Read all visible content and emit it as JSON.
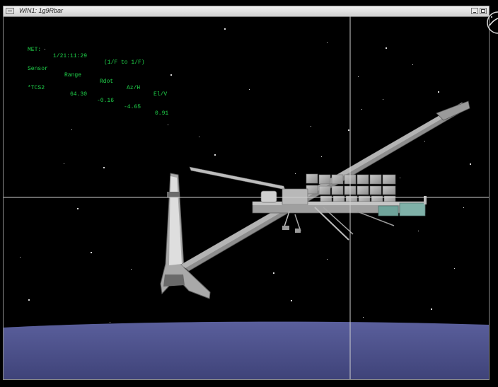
{
  "window": {
    "title": "WIN1: 1g9Rbar"
  },
  "telemetry": {
    "met_label": "MET:",
    "met_value": "1/21:11:29",
    "mode": "(1/F to 1/F)",
    "headers": [
      "Sensor",
      "Range",
      "Rdot",
      "Az/H",
      "El/V"
    ],
    "row": [
      "*TCS2",
      "64.30",
      "-0.16",
      "-4.65",
      "0.91"
    ]
  },
  "colors": {
    "telemetry_text": "#1fd24a",
    "sky": "#000000",
    "earth": "#4a4f8a"
  },
  "icons": {
    "logo": "nasa-logo"
  }
}
